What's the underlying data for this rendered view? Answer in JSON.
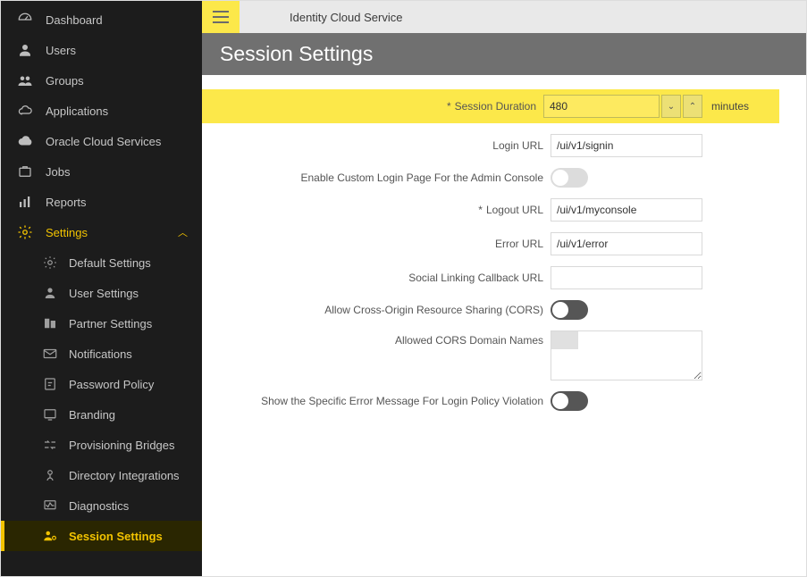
{
  "sidebar": {
    "items": [
      {
        "label": "Dashboard"
      },
      {
        "label": "Users"
      },
      {
        "label": "Groups"
      },
      {
        "label": "Applications"
      },
      {
        "label": "Oracle Cloud Services"
      },
      {
        "label": "Jobs"
      },
      {
        "label": "Reports"
      },
      {
        "label": "Settings"
      }
    ],
    "subitems": [
      {
        "label": "Default Settings"
      },
      {
        "label": "User Settings"
      },
      {
        "label": "Partner Settings"
      },
      {
        "label": "Notifications"
      },
      {
        "label": "Password Policy"
      },
      {
        "label": "Branding"
      },
      {
        "label": "Provisioning Bridges"
      },
      {
        "label": "Directory Integrations"
      },
      {
        "label": "Diagnostics"
      },
      {
        "label": "Session Settings"
      }
    ]
  },
  "header": {
    "service_title": "Identity Cloud Service"
  },
  "page": {
    "title": "Session Settings"
  },
  "form": {
    "session_duration": {
      "label": "Session Duration",
      "value": "480",
      "unit": "minutes"
    },
    "login_url": {
      "label": "Login URL",
      "value": "/ui/v1/signin"
    },
    "enable_custom_login": {
      "label": "Enable Custom Login Page For the Admin Console"
    },
    "logout_url": {
      "label": "Logout URL",
      "value": "/ui/v1/myconsole"
    },
    "error_url": {
      "label": "Error URL",
      "value": "/ui/v1/error"
    },
    "social_callback": {
      "label": "Social Linking Callback URL",
      "value": ""
    },
    "allow_cors": {
      "label": "Allow Cross-Origin Resource Sharing (CORS)"
    },
    "cors_domains": {
      "label": "Allowed CORS Domain Names",
      "value": ""
    },
    "show_specific_error": {
      "label": "Show the Specific Error Message For Login Policy Violation"
    }
  }
}
